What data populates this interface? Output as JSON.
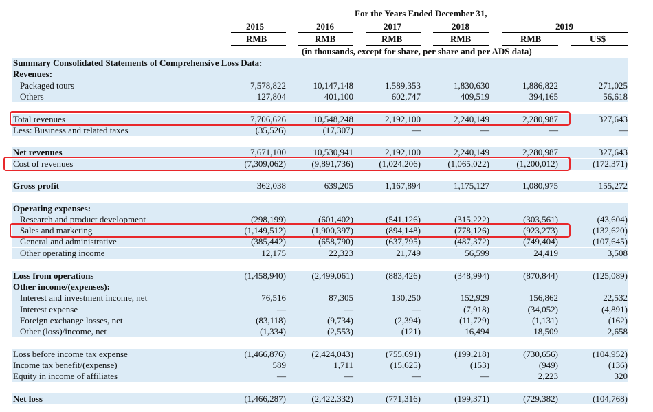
{
  "header": {
    "period": "For the Years Ended December 31,",
    "years": [
      "2015",
      "2016",
      "2017",
      "2018",
      "2019"
    ],
    "currencies": [
      "RMB",
      "RMB",
      "RMB",
      "RMB",
      "RMB",
      "US$"
    ],
    "units": "(in thousands, except for share, per share and per ADS data)"
  },
  "rows": [
    {
      "label": "Summary Consolidated Statements of Comprehensive Loss Data:",
      "bold": true,
      "values": []
    },
    {
      "label": "Revenues:",
      "bold": true,
      "values": []
    },
    {
      "label": "Packaged tours",
      "indent": true,
      "values": [
        "7,578,822",
        "10,147,148",
        "1,589,353",
        "1,830,630",
        "1,886,822",
        "271,025"
      ]
    },
    {
      "label": "Others",
      "indent": true,
      "values": [
        "127,804",
        "401,100",
        "602,747",
        "409,519",
        "394,165",
        "56,618"
      ]
    },
    {
      "label": "",
      "values": []
    },
    {
      "label": "Total revenues",
      "values": [
        "7,706,626",
        "10,548,248",
        "2,192,100",
        "2,240,149",
        "2,280,987",
        "327,643"
      ]
    },
    {
      "label": "Less: Business and related taxes",
      "values": [
        "(35,526)",
        "(17,307)",
        "—",
        "—",
        "—",
        "—"
      ]
    },
    {
      "label": "",
      "values": []
    },
    {
      "label": "Net revenues",
      "bold": true,
      "values": [
        "7,671,100",
        "10,530,941",
        "2,192,100",
        "2,240,149",
        "2,280,987",
        "327,643"
      ]
    },
    {
      "label": "Cost of revenues",
      "values": [
        "(7,309,062)",
        "(9,891,736)",
        "(1,024,206)",
        "(1,065,022)",
        "(1,200,012)",
        "(172,371)"
      ]
    },
    {
      "label": "",
      "values": []
    },
    {
      "label": "Gross profit",
      "bold": true,
      "values": [
        "362,038",
        "639,205",
        "1,167,894",
        "1,175,127",
        "1,080,975",
        "155,272"
      ]
    },
    {
      "label": "",
      "values": []
    },
    {
      "label": "Operating expenses:",
      "bold": true,
      "values": []
    },
    {
      "label": "Research and product development",
      "indent": true,
      "values": [
        "(298,199)",
        "(601,402)",
        "(541,126)",
        "(315,222)",
        "(303,561)",
        "(43,604)"
      ]
    },
    {
      "label": "Sales and marketing",
      "indent": true,
      "values": [
        "(1,149,512)",
        "(1,900,397)",
        "(894,148)",
        "(778,126)",
        "(923,273)",
        "(132,620)"
      ]
    },
    {
      "label": "General and administrative",
      "indent": true,
      "values": [
        "(385,442)",
        "(658,790)",
        "(637,795)",
        "(487,372)",
        "(749,404)",
        "(107,645)"
      ]
    },
    {
      "label": "Other operating income",
      "indent": true,
      "values": [
        "12,175",
        "22,323",
        "21,749",
        "56,599",
        "24,419",
        "3,508"
      ]
    },
    {
      "label": "",
      "values": []
    },
    {
      "label": "Loss from operations",
      "bold": true,
      "values": [
        "(1,458,940)",
        "(2,499,061)",
        "(883,426)",
        "(348,994)",
        "(870,844)",
        "(125,089)"
      ]
    },
    {
      "label": "Other income/(expenses):",
      "bold": true,
      "values": []
    },
    {
      "label": "Interest and investment income, net",
      "indent": true,
      "values": [
        "76,516",
        "87,305",
        "130,250",
        "152,929",
        "156,862",
        "22,532"
      ]
    },
    {
      "label": "Interest expense",
      "indent": true,
      "values": [
        "—",
        "—",
        "—",
        "(7,918)",
        "(34,052)",
        "(4,891)"
      ]
    },
    {
      "label": "Foreign exchange losses, net",
      "indent": true,
      "values": [
        "(83,118)",
        "(9,734)",
        "(2,394)",
        "(11,729)",
        "(1,131)",
        "(162)"
      ]
    },
    {
      "label": "Other (loss)/income, net",
      "indent": true,
      "values": [
        "(1,334)",
        "(2,553)",
        "(121)",
        "16,494",
        "18,509",
        "2,658"
      ]
    },
    {
      "label": "",
      "values": []
    },
    {
      "label": "Loss before income tax expense",
      "values": [
        "(1,466,876)",
        "(2,424,043)",
        "(755,691)",
        "(199,218)",
        "(730,656)",
        "(104,952)"
      ]
    },
    {
      "label": "Income tax benefit/(expense)",
      "values": [
        "589",
        "1,711",
        "(15,625)",
        "(153)",
        "(949)",
        "(136)"
      ]
    },
    {
      "label": "Equity in income of affiliates",
      "values": [
        "—",
        "—",
        "—",
        "—",
        "2,223",
        "320"
      ]
    },
    {
      "label": "",
      "values": []
    },
    {
      "label": "Net loss",
      "bold": true,
      "values": [
        "(1,466,287)",
        "(2,422,332)",
        "(771,316)",
        "(199,371)",
        "(729,382)",
        "(104,768)"
      ]
    }
  ],
  "highlight_color": "#e8282b",
  "shade_color": "#dcebf6"
}
